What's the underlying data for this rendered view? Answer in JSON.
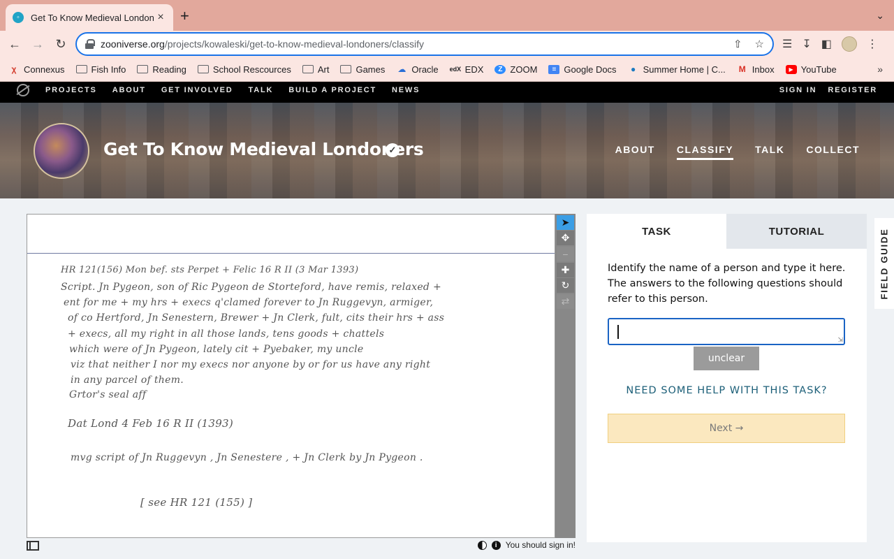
{
  "browser": {
    "tab_title": "Get To Know Medieval Londoners",
    "url_domain": "zooniverse.org",
    "url_path": "/projects/kowaleski/get-to-know-medieval-londoners/classify",
    "bookmarks": [
      {
        "label": "Connexus",
        "icon": "connexus-icon"
      },
      {
        "label": "Fish Info",
        "icon": "folder-icon"
      },
      {
        "label": "Reading",
        "icon": "folder-icon"
      },
      {
        "label": "School Rescources",
        "icon": "folder-icon"
      },
      {
        "label": "Art",
        "icon": "folder-icon"
      },
      {
        "label": "Games",
        "icon": "folder-icon"
      },
      {
        "label": "Oracle",
        "icon": "cloud-icon"
      },
      {
        "label": "EDX",
        "icon": "edx-icon"
      },
      {
        "label": "ZOOM",
        "icon": "zoom-icon"
      },
      {
        "label": "Google Docs",
        "icon": "docs-icon"
      },
      {
        "label": "Summer Home | C...",
        "icon": "summer-icon"
      },
      {
        "label": "Inbox",
        "icon": "gmail-icon"
      },
      {
        "label": "YouTube",
        "icon": "youtube-icon"
      }
    ]
  },
  "zoo_nav": {
    "links": [
      "PROJECTS",
      "ABOUT",
      "GET INVOLVED",
      "TALK",
      "BUILD A PROJECT",
      "NEWS"
    ],
    "sign_in": "SIGN IN",
    "register": "REGISTER"
  },
  "project": {
    "title": "Get To Know Medieval Londoners",
    "tabs": {
      "about": "ABOUT",
      "classify": "CLASSIFY",
      "talk": "TALK",
      "collect": "COLLECT"
    }
  },
  "subject_lines": [
    "HR 121(156)  Mon bef. sts Perpet + Felic  16 R II                          (3 Mar 1393)",
    "Script.  Jn Pygeon, son of Ric Pygeon de Storteford, have remis, relaxed +",
    "ent for me + my hrs + execs q'clamed forever  to Jn Ruggevyn, armiger,",
    "of co Hertford,  Jn Senestern, Brewer + Jn Clerk, fult,  cits  their hrs + ass",
    "+ execs,  all my right  in all those  lands, tens goods + chattels",
    "which  were of Jn Pygeon, lately cit + Pyebaker,  my uncle",
    "viz that neither I nor my execs nor anyone by or for us have any right",
    "in any parcel of them.",
    "Grtor's   seal  aff",
    "Dat  Lond  4 Feb  16 R II  (1393)",
    "mvg    script of  Jn Ruggevyn ,  Jn Senestere , + Jn Clerk  by  Jn Pygeon .",
    "[ see HR 121 (155) ]"
  ],
  "viewer_footer": {
    "sign_in_notice": "You should sign in!"
  },
  "task": {
    "tab_task": "TASK",
    "tab_tutorial": "TUTORIAL",
    "question": "Identify the name of a person and type it here. The answers to the following questions should refer to this person.",
    "input_value": "",
    "unclear_label": "unclear",
    "help_label": "NEED SOME HELP WITH THIS TASK?",
    "next_label": "Next →"
  },
  "field_guide": "FIELD GUIDE",
  "colors": {
    "accent_blue": "#1a63c4",
    "next_bg": "#fbe8bf",
    "help_link": "#1c5f78",
    "tabbar": "#e2a89c"
  }
}
